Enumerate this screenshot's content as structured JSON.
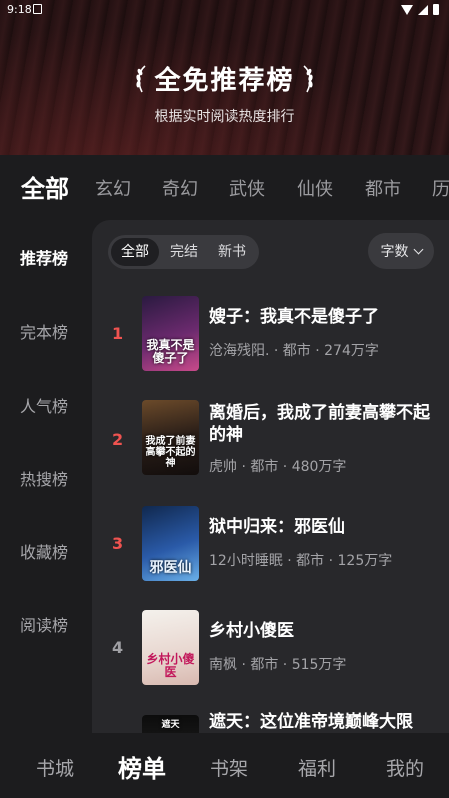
{
  "status_bar": {
    "time": "9:18"
  },
  "banner": {
    "title": "全免推荐榜",
    "subtitle": "根据实时阅读热度排行"
  },
  "category_tabs": [
    {
      "label": "全部",
      "active": true
    },
    {
      "label": "玄幻",
      "active": false
    },
    {
      "label": "奇幻",
      "active": false
    },
    {
      "label": "武侠",
      "active": false
    },
    {
      "label": "仙侠",
      "active": false
    },
    {
      "label": "都市",
      "active": false
    },
    {
      "label": "历",
      "active": false
    }
  ],
  "sidebar": {
    "items": [
      {
        "label": "推荐榜",
        "active": true
      },
      {
        "label": "完本榜",
        "active": false
      },
      {
        "label": "人气榜",
        "active": false
      },
      {
        "label": "热搜榜",
        "active": false
      },
      {
        "label": "收藏榜",
        "active": false
      },
      {
        "label": "阅读榜",
        "active": false
      }
    ]
  },
  "filters": {
    "chips": [
      {
        "label": "全部",
        "active": true
      },
      {
        "label": "完结",
        "active": false
      },
      {
        "label": "新书",
        "active": false
      }
    ],
    "sort_label": "字数"
  },
  "books": [
    {
      "rank": "1",
      "title": "嫂子：我真不是傻子了",
      "meta": "沧海残阳. · 都市 · 274万字",
      "cover_text": "我真不是傻子了",
      "cover_colors": [
        "#4b2a6b",
        "#c23a7a"
      ]
    },
    {
      "rank": "2",
      "title": "离婚后，我成了前妻高攀不起的神",
      "meta": "虎帅 · 都市 · 480万字",
      "cover_text": "我成了前妻高攀不起的神",
      "cover_colors": [
        "#3a2a1e",
        "#8a5a2a"
      ]
    },
    {
      "rank": "3",
      "title": "狱中归来：邪医仙",
      "meta": "12小时睡眠 · 都市 · 125万字",
      "cover_text": "邪医仙",
      "cover_colors": [
        "#1e3a6e",
        "#5a8ad8"
      ]
    },
    {
      "rank": "4",
      "title": "乡村小傻医",
      "meta": "南枫 · 都市 · 515万字",
      "cover_text": "乡村小傻医",
      "cover_colors": [
        "#f1ede6",
        "#e1c9c0"
      ]
    },
    {
      "rank": "",
      "title": "遮天：这位准帝境巅峰大限",
      "meta": "",
      "cover_text": "遮天",
      "cover_colors": [
        "#101010",
        "#303030"
      ]
    }
  ],
  "bottom_nav": [
    {
      "label": "书城",
      "active": false
    },
    {
      "label": "榜单",
      "active": true
    },
    {
      "label": "书架",
      "active": false
    },
    {
      "label": "福利",
      "active": false
    },
    {
      "label": "我的",
      "active": false
    }
  ]
}
